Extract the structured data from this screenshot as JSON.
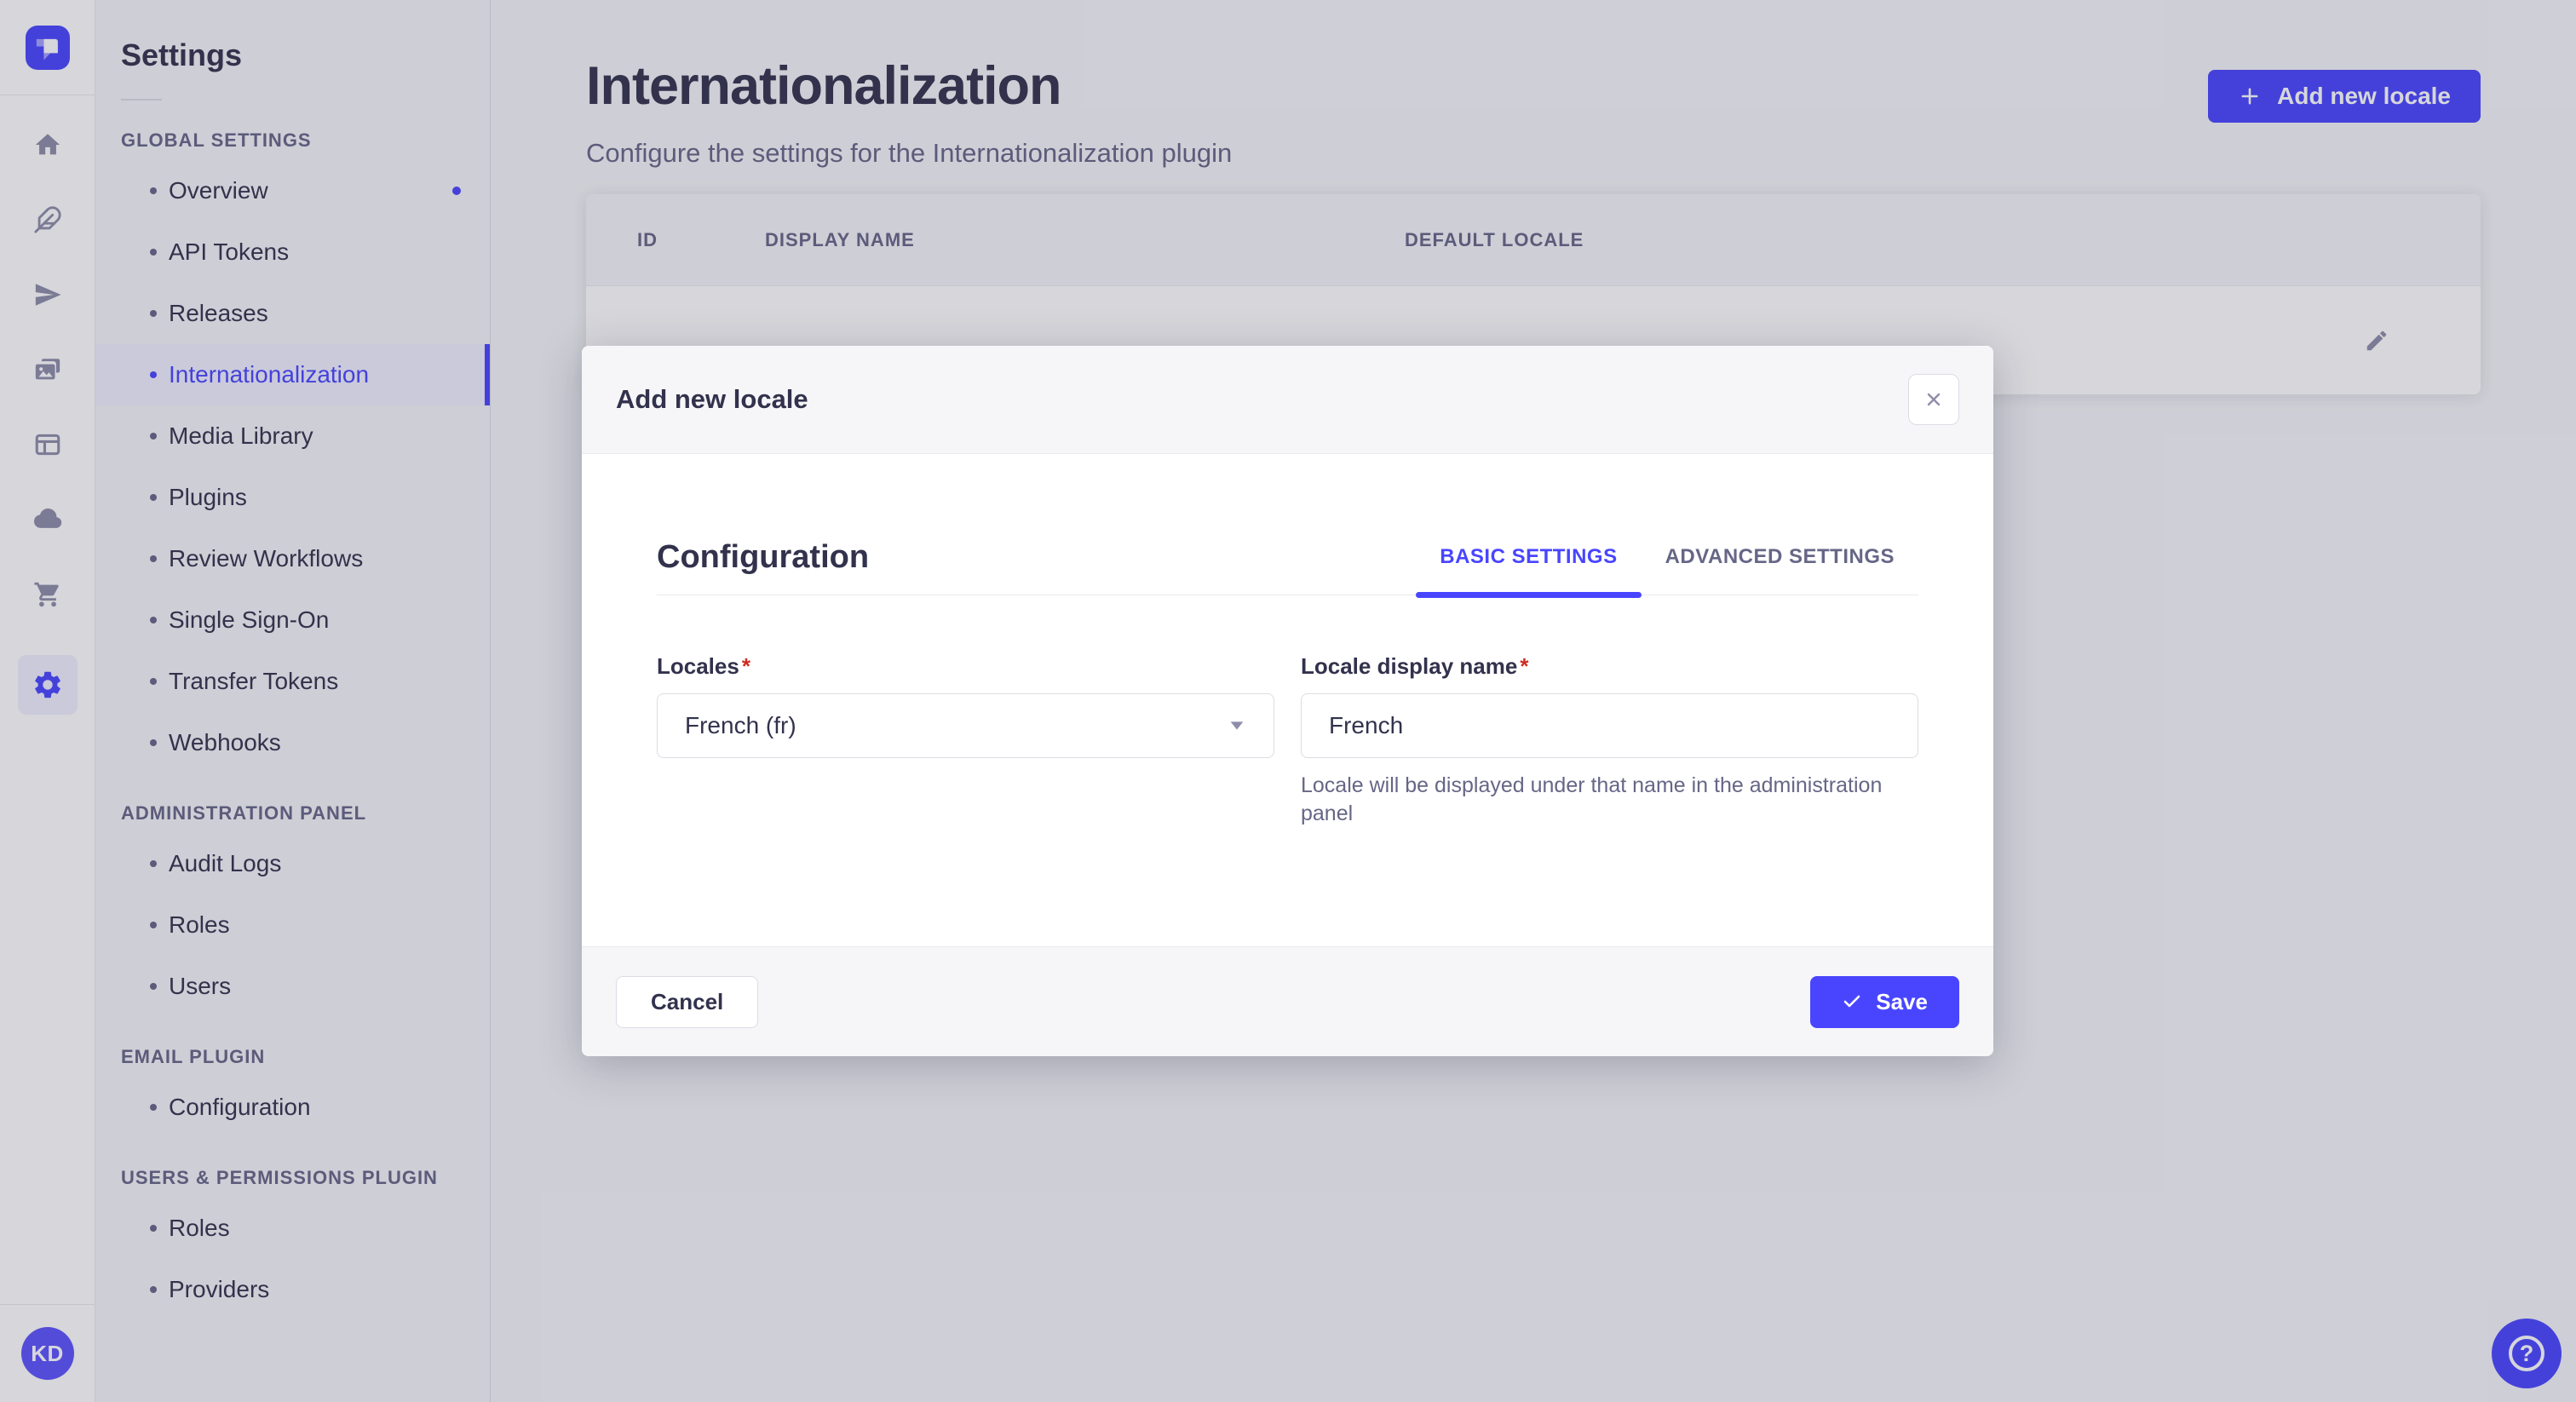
{
  "colors": {
    "primary": "#4945ff",
    "primary_light_bg": "#f0f0ff",
    "overlay": "rgba(50,50,77,0.2)",
    "required_red": "#d02b20",
    "text_dark": "#32324d",
    "text_muted": "#666687"
  },
  "icon_sidebar": {
    "logo_icon": "strapi-logo",
    "nav_icons": [
      "home-icon",
      "feather-icon",
      "paper-plane-icon",
      "media-icon",
      "layout-icon",
      "cloud-icon",
      "cart-icon",
      "gear-icon"
    ],
    "active_icon": "gear-icon",
    "avatar_initials": "KD"
  },
  "settings_nav": {
    "title": "Settings",
    "sections": [
      {
        "heading": "GLOBAL SETTINGS",
        "items": [
          {
            "label": "Overview",
            "has_notification": true
          },
          {
            "label": "API Tokens"
          },
          {
            "label": "Releases"
          },
          {
            "label": "Internationalization",
            "active": true
          },
          {
            "label": "Media Library"
          },
          {
            "label": "Plugins"
          },
          {
            "label": "Review Workflows"
          },
          {
            "label": "Single Sign-On"
          },
          {
            "label": "Transfer Tokens"
          },
          {
            "label": "Webhooks"
          }
        ]
      },
      {
        "heading": "ADMINISTRATION PANEL",
        "items": [
          {
            "label": "Audit Logs"
          },
          {
            "label": "Roles"
          },
          {
            "label": "Users"
          }
        ]
      },
      {
        "heading": "EMAIL PLUGIN",
        "items": [
          {
            "label": "Configuration"
          }
        ]
      },
      {
        "heading": "USERS & PERMISSIONS PLUGIN",
        "items": [
          {
            "label": "Roles"
          },
          {
            "label": "Providers"
          }
        ]
      }
    ]
  },
  "page": {
    "title": "Internationalization",
    "subtitle": "Configure the settings for the Internationalization plugin",
    "add_button_label": "Add new locale"
  },
  "locales_table": {
    "columns": [
      "ID",
      "DISPLAY NAME",
      "DEFAULT LOCALE"
    ],
    "row_action_icon": "pencil-icon"
  },
  "modal": {
    "title": "Add new locale",
    "section_heading": "Configuration",
    "tabs": [
      {
        "label": "BASIC SETTINGS",
        "active": true
      },
      {
        "label": "ADVANCED SETTINGS",
        "active": false
      }
    ],
    "locales_field": {
      "label": "Locales",
      "required_mark": "*",
      "value": "French (fr)"
    },
    "display_name_field": {
      "label": "Locale display name",
      "required_mark": "*",
      "value": "French",
      "hint": "Locale will be displayed under that name in the administration panel"
    },
    "cancel_label": "Cancel",
    "save_label": "Save"
  },
  "help_button": {
    "icon": "question-mark-icon",
    "glyph": "?"
  }
}
